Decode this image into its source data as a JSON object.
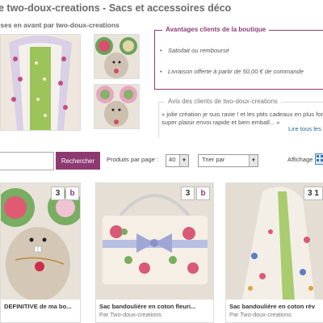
{
  "header": {
    "shop_title": "e two-doux-creations - Sacs et accessoires déco",
    "featured_title": "ises en avant par two-doux-creations"
  },
  "featured": {
    "main_image": "bag-photo",
    "small_images": [
      "mouse-plush-photo",
      "mouse-plush-photo"
    ]
  },
  "advantages": {
    "title": "Avantages clients de la boutique",
    "items": [
      "Satisfait ou remboursé",
      "Livraison offerte à partir de 50,00 € de commande"
    ]
  },
  "reviews": {
    "title": "Avis des clients de two-doux-creations",
    "quote": "« jolie création je suis ravie ! et les ptits cadeaux en plus font super plaisir envoi rapide et bien emball... »",
    "more_link": "Lire tous les"
  },
  "search": {
    "value": "",
    "button": "Rechercher"
  },
  "listing": {
    "per_page_label": "Produits par page :",
    "per_page_value": "40",
    "sort_value": "Trier par",
    "display_label": "Affichage :"
  },
  "products": [
    {
      "name": "DEFINITIVE de ma bo...",
      "by": "",
      "count": "3",
      "badge": "b"
    },
    {
      "name": "Sac bandoulière en coton fleuri...",
      "by": "Par Two-doux-creations",
      "count": "3",
      "badge": "b"
    },
    {
      "name": "Sac bandoulière en coton rév",
      "by": "Par Two-doux-creations",
      "count": "3 1",
      "badge": ""
    }
  ],
  "colors": {
    "accent": "#8d3a73",
    "link": "#246b9a",
    "border": "#dddddd"
  }
}
